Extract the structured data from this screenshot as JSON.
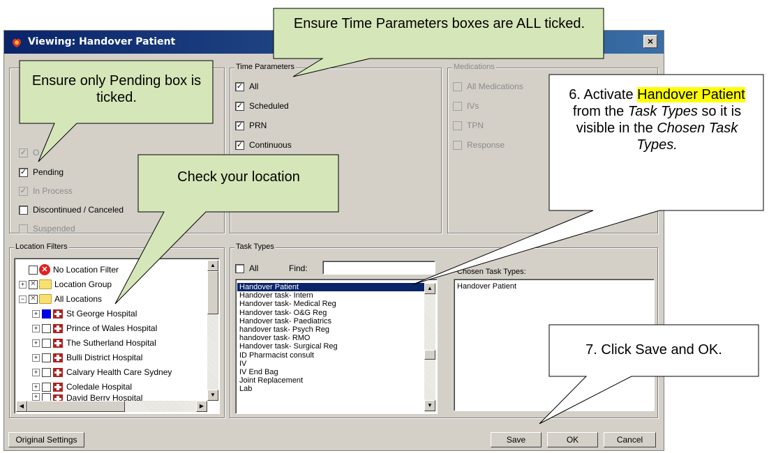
{
  "window": {
    "title": "Viewing:  Handover Patient",
    "close_label": "×"
  },
  "status_group": {
    "items": [
      {
        "label": "O",
        "checked": true,
        "disabled": true
      },
      {
        "label": "Pending",
        "checked": true,
        "disabled": false
      },
      {
        "label": "In Process",
        "checked": true,
        "disabled": true
      },
      {
        "label": "Discontinued / Canceled",
        "checked": false,
        "disabled": false
      },
      {
        "label": "Suspended",
        "checked": false,
        "disabled": true
      }
    ]
  },
  "time_parameters": {
    "title": "Time Parameters",
    "items": [
      {
        "label": "All",
        "checked": true
      },
      {
        "label": "Scheduled",
        "checked": true
      },
      {
        "label": "PRN",
        "checked": true
      },
      {
        "label": "Continuous",
        "checked": true
      }
    ]
  },
  "medications": {
    "title": "Medications",
    "items": [
      {
        "label": "All Medications"
      },
      {
        "label": "IVs"
      },
      {
        "label": "TPN"
      },
      {
        "label": "Response"
      }
    ]
  },
  "location_filters": {
    "title": "Location Filters",
    "items": [
      {
        "label": "No Location Filter",
        "icon": "red-x-icon"
      },
      {
        "label": "Location Group",
        "icon": "folder-icon"
      },
      {
        "label": "All Locations",
        "icon": "folder-icon"
      },
      {
        "label": "St George Hospital",
        "icon": "hospital-icon",
        "selected": true
      },
      {
        "label": "Prince of Wales Hospital",
        "icon": "hospital-icon"
      },
      {
        "label": "The Sutherland Hospital",
        "icon": "hospital-icon"
      },
      {
        "label": "Bulli District Hospital",
        "icon": "hospital-icon"
      },
      {
        "label": "Calvary Health Care Sydney",
        "icon": "hospital-icon"
      },
      {
        "label": "Coledale Hospital",
        "icon": "hospital-icon"
      },
      {
        "label": "David Berry Hospital",
        "icon": "hospital-icon"
      }
    ]
  },
  "task_types": {
    "title": "Task Types",
    "all_label": "All",
    "find_label": "Find:",
    "find_value": "",
    "items": [
      "Handover Patient",
      "Handover task- Intern",
      "Handover task- Medical Reg",
      "Handover task- O&G Reg",
      "Handover task- Paediatrics",
      "handover task- Psych Reg",
      "handover task- RMO",
      "Handover task- Surgical Reg",
      "ID Pharmacist consult",
      "IV",
      "IV End Bag",
      "Joint Replacement",
      "Lab"
    ],
    "selected_index": 0,
    "chosen_label": "Chosen Task Types:",
    "chosen_items": [
      "Handover Patient"
    ]
  },
  "buttons": {
    "original_settings": "Original Settings",
    "save": "Save",
    "ok": "OK",
    "cancel": "Cancel"
  },
  "callouts": {
    "time_params": "Ensure Time Parameters boxes are ALL ticked.",
    "pending": "Ensure only Pending box is ticked.",
    "location": "Check your location",
    "activate_prefix": "6. Activate ",
    "activate_hl": "Handover Patient",
    "activate_mid": " from the ",
    "activate_task_types": "Task Types",
    "activate_mid2": " so it is visible in the ",
    "activate_chosen": "Chosen Task Types.",
    "save_ok": "7. Click Save and OK."
  },
  "colors": {
    "callout_green": "#d5e6b8",
    "titlebar": "#0a246a",
    "highlight": "#ffff00"
  }
}
